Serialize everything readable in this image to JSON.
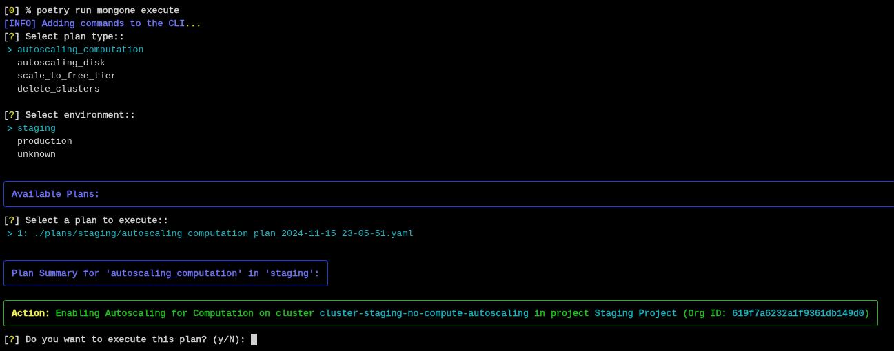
{
  "session": [
    {
      "kind": "command",
      "parts": [
        {
          "text": "[",
          "color": "#d6d6d6"
        },
        {
          "text": "0",
          "color": "#d9d92a"
        },
        {
          "text": "] % poetry run mongone execute",
          "color": "#d6d6d6"
        }
      ]
    },
    {
      "kind": "info",
      "parts": [
        {
          "text": "[INFO] Adding commands to the CLI",
          "color": "#6f77ff"
        },
        {
          "text": "...",
          "color": "#d9d92a"
        }
      ]
    },
    {
      "kind": "select",
      "parts": [
        {
          "text": "[",
          "color": "#d6d6d6"
        },
        {
          "text": "?",
          "color": "#d9d92a"
        },
        {
          "text": "] Select plan type::",
          "color": "#d6d6d6"
        }
      ],
      "options": [
        {
          "label": "autoscaling_computation",
          "selected": true
        },
        {
          "label": "autoscaling_disk",
          "selected": false
        },
        {
          "label": "scale_to_free_tier",
          "selected": false
        },
        {
          "label": "delete_clusters",
          "selected": false
        }
      ]
    },
    {
      "kind": "gap"
    },
    {
      "kind": "select",
      "parts": [
        {
          "text": "[",
          "color": "#d6d6d6"
        },
        {
          "text": "?",
          "color": "#d9d92a"
        },
        {
          "text": "] Select environment::",
          "color": "#d6d6d6"
        }
      ],
      "options": [
        {
          "label": "staging",
          "selected": true
        },
        {
          "label": "production",
          "selected": false
        },
        {
          "label": "unknown",
          "selected": false
        }
      ]
    },
    {
      "kind": "gap"
    },
    {
      "kind": "panel",
      "full_width": true,
      "parts": [
        {
          "text": "Available Plans:",
          "color": "#6f77ff"
        }
      ]
    },
    {
      "kind": "select",
      "parts": [
        {
          "text": "[",
          "color": "#d6d6d6"
        },
        {
          "text": "?",
          "color": "#d9d92a"
        },
        {
          "text": "] Select a plan to execute::",
          "color": "#d6d6d6"
        }
      ],
      "options": [
        {
          "label": "1: ./plans/staging/autoscaling_computation_plan_2024-11-15_23-05-51.yaml",
          "selected": true
        }
      ]
    },
    {
      "kind": "gap"
    },
    {
      "kind": "panel",
      "full_width": false,
      "parts": [
        {
          "text": "Plan Summary for 'autoscaling_computation' in 'staging':",
          "color": "#6f77ff"
        }
      ]
    },
    {
      "kind": "action",
      "parts": [
        {
          "text": "**Action:**",
          "color": "#f2f25c"
        },
        {
          "text": " Enabling Autoscaling for Computation on cluster ",
          "color": "#22c322"
        },
        {
          "text": "cluster-staging-no-compute-autoscaling",
          "color": "#19b6c2"
        },
        {
          "text": " in project ",
          "color": "#22c322"
        },
        {
          "text": "Staging Project",
          "color": "#19b6c2"
        },
        {
          "text": " (Org ID: ",
          "color": "#22c322"
        },
        {
          "text": "619f7a6232a1f9361db149d0",
          "color": "#19b6c2"
        },
        {
          "text": ")",
          "color": "#22c322"
        }
      ]
    },
    {
      "kind": "prompt",
      "cursor": true,
      "parts": [
        {
          "text": "[",
          "color": "#d6d6d6"
        },
        {
          "text": "?",
          "color": "#d9d92a"
        },
        {
          "text": "] Do you want to execute this plan? (y/N): ",
          "color": "#d6d6d6"
        }
      ]
    }
  ]
}
